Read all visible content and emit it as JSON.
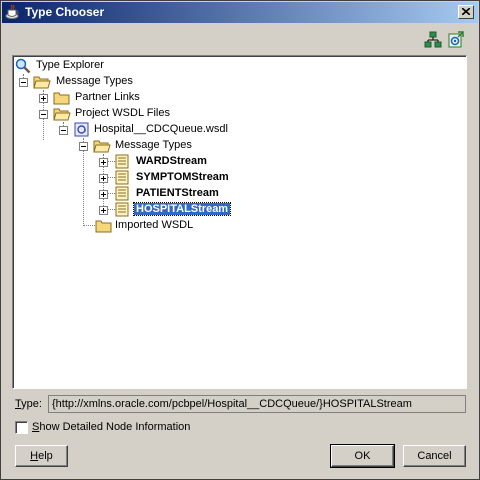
{
  "window": {
    "title": "Type Chooser"
  },
  "toolbar": {
    "icons": [
      "hierarchy-icon",
      "import-schema-icon"
    ]
  },
  "tree": {
    "root": "Type Explorer",
    "message_types": "Message Types",
    "partner_links": "Partner Links",
    "project_wsdl_files": "Project WSDL Files",
    "wsdl_file": "Hospital__CDCQueue.wsdl",
    "wsdl_message_types": "Message Types",
    "streams": [
      "WARDStream",
      "SYMPTOMStream",
      "PATIENTStream",
      "HOSPITALStream"
    ],
    "imported_wsdl": "Imported WSDL",
    "selected": "HOSPITALStream"
  },
  "type_field": {
    "label_mnemonic": "T",
    "label_rest": "ype:",
    "value": "{http://xmlns.oracle.com/pcbpel/Hospital__CDCQueue/}HOSPITALStream"
  },
  "detail_checkbox": {
    "mnemonic": "S",
    "label_rest": "how Detailed Node Information",
    "checked": false
  },
  "buttons": {
    "help_mnemonic": "H",
    "help_rest": "elp",
    "ok": "OK",
    "cancel": "Cancel"
  }
}
